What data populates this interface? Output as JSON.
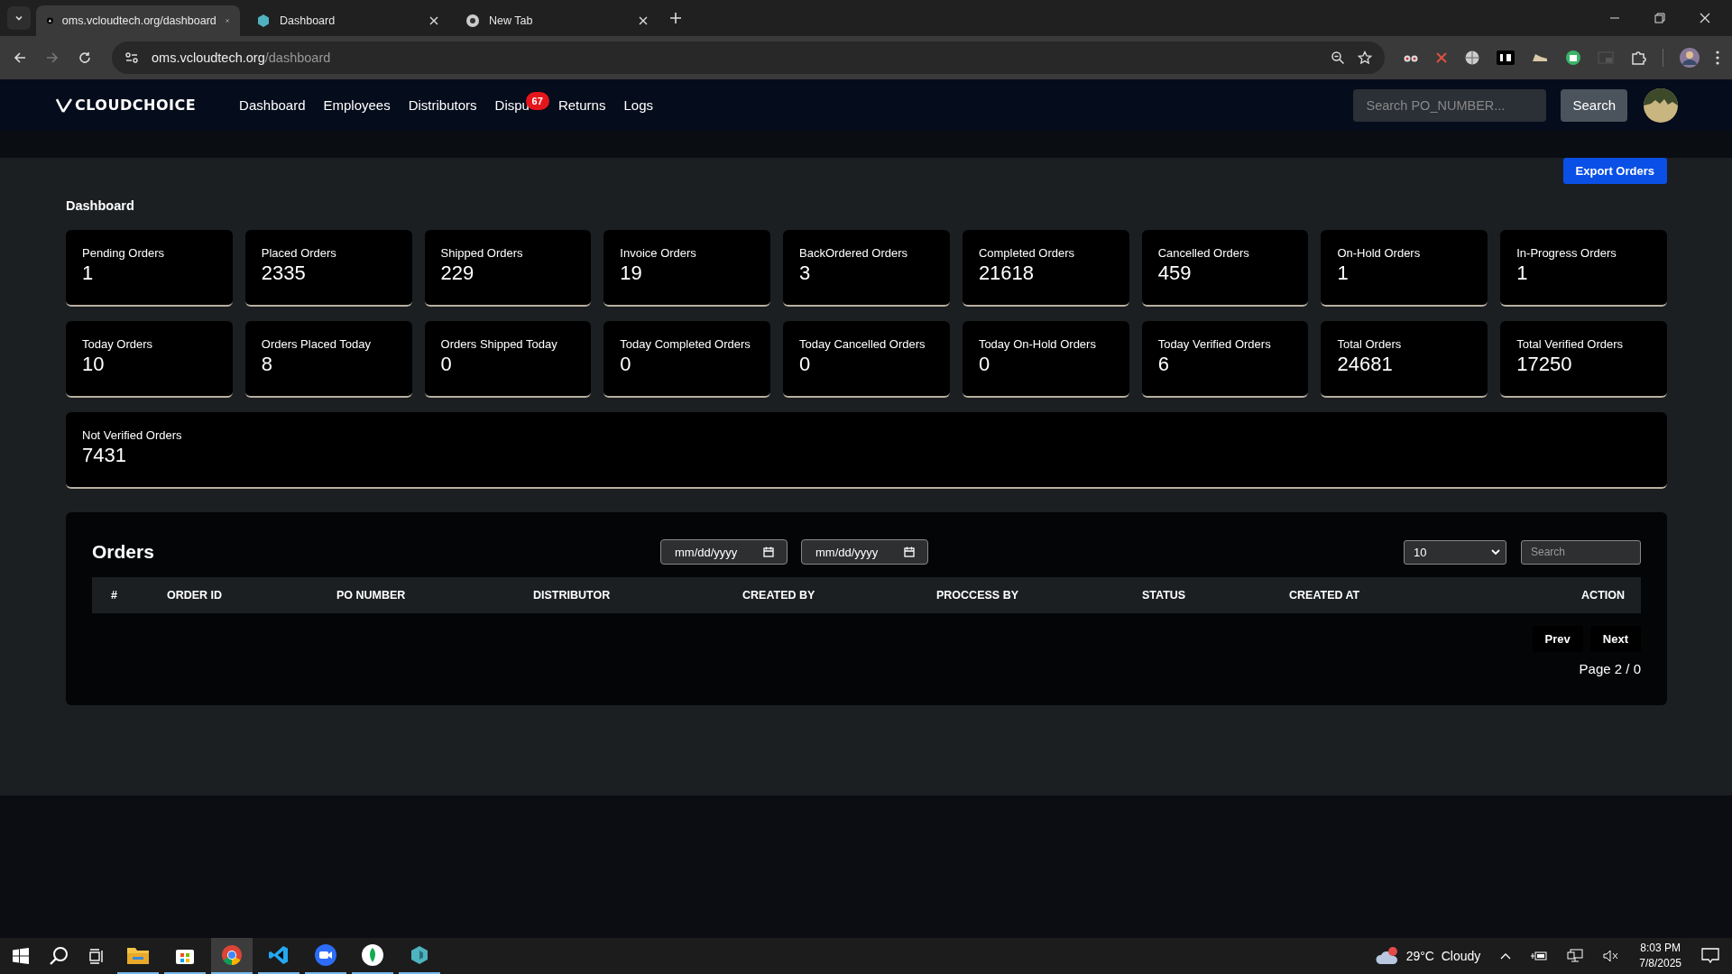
{
  "browser": {
    "tabs": [
      {
        "title": "oms.vcloudtech.org/dashboard",
        "selected": true,
        "kind": "site"
      },
      {
        "title": "Dashboard",
        "selected": false,
        "kind": "app"
      },
      {
        "title": "New Tab",
        "selected": false,
        "kind": "chrome"
      }
    ],
    "address": {
      "host": "oms.vcloudtech.org",
      "path": "/dashboard"
    }
  },
  "nav": {
    "logo": "CLOUDCHOICE",
    "links": [
      {
        "label": "Dashboard"
      },
      {
        "label": "Employees"
      },
      {
        "label": "Distributors"
      },
      {
        "label": "Dispu",
        "badge": "67"
      },
      {
        "label": "Returns"
      },
      {
        "label": "Logs"
      }
    ],
    "search": {
      "placeholder": "Search PO_NUMBER..."
    },
    "search_button": "Search"
  },
  "export_button": "Export Orders",
  "page_title": "Dashboard",
  "stats": [
    {
      "label": "Pending Orders",
      "value": "1"
    },
    {
      "label": "Placed Orders",
      "value": "2335"
    },
    {
      "label": "Shipped Orders",
      "value": "229"
    },
    {
      "label": "Invoice Orders",
      "value": "19"
    },
    {
      "label": "BackOrdered Orders",
      "value": "3"
    },
    {
      "label": "Completed Orders",
      "value": "21618"
    },
    {
      "label": "Cancelled Orders",
      "value": "459"
    },
    {
      "label": "On-Hold Orders",
      "value": "1"
    },
    {
      "label": "In-Progress Orders",
      "value": "1"
    },
    {
      "label": "Today Orders",
      "value": "10"
    },
    {
      "label": "Orders Placed Today",
      "value": "8"
    },
    {
      "label": "Orders Shipped Today",
      "value": "0"
    },
    {
      "label": "Today Completed Orders",
      "value": "0"
    },
    {
      "label": "Today Cancelled Orders",
      "value": "0"
    },
    {
      "label": "Today On-Hold Orders",
      "value": "0"
    },
    {
      "label": "Today Verified Orders",
      "value": "6"
    },
    {
      "label": "Total Orders",
      "value": "24681"
    },
    {
      "label": "Total Verified Orders",
      "value": "17250"
    },
    {
      "label": "Not Verified Orders",
      "value": "7431"
    }
  ],
  "orders": {
    "title": "Orders",
    "date_from": "mm/dd/yyyy",
    "date_to": "mm/dd/yyyy",
    "page_size": "10",
    "search": {
      "placeholder": "Search"
    },
    "columns": [
      "#",
      "ORDER ID",
      "PO NUMBER",
      "DISTRIBUTOR",
      "CREATED BY",
      "PROCCESS BY",
      "STATUS",
      "CREATED AT",
      "ACTION"
    ],
    "prev": "Prev",
    "next": "Next",
    "page_info": "Page 2 / 0"
  },
  "taskbar": {
    "weather": "29°C  Cloudy",
    "time": "8:03 PM",
    "date": "7/8/2025",
    "apps": [
      {
        "kind": "explorer",
        "selected": false
      },
      {
        "kind": "store",
        "selected": false
      },
      {
        "kind": "chrome",
        "selected": true
      },
      {
        "kind": "vscode",
        "selected": false
      },
      {
        "kind": "zoom",
        "selected": false
      },
      {
        "kind": "mongo",
        "selected": false
      },
      {
        "kind": "app",
        "selected": false
      }
    ]
  }
}
